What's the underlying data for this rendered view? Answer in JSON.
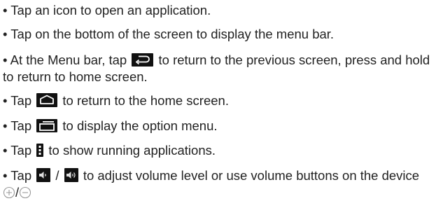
{
  "instructions": [
    {
      "bullet": "•",
      "text": "Tap an icon to open an application."
    },
    {
      "bullet": "•",
      "text": "Tap on the bottom of the screen to display the menu bar."
    },
    {
      "bullet": "•",
      "before": "At the Menu bar, tap",
      "icon": "back-arrow-icon",
      "after": "to return to the previous screen, press and hold to return to home screen."
    },
    {
      "bullet": "•",
      "before": "Tap",
      "icon": "home-icon",
      "after": "to return to the home screen."
    },
    {
      "bullet": "•",
      "before": "Tap",
      "icon": "menu-icon",
      "after": "to display the option menu."
    },
    {
      "bullet": "•",
      "before": "Tap",
      "icon": "recent-apps-icon",
      "after": "to show running applications."
    },
    {
      "bullet": "•",
      "before": "Tap",
      "icon_a": "volume-down-icon",
      "separator": "/",
      "icon_b": "volume-up-icon",
      "after": "to adjust volume level or use volume buttons on the device",
      "icon_c": "plus-circle-icon",
      "separator2": "/",
      "icon_d": "minus-circle-icon"
    }
  ],
  "colors": {
    "text": "#222222",
    "icon_bg": "#111111",
    "icon_fg": "#ffffff",
    "circle_stroke": "#9a9a9a"
  }
}
